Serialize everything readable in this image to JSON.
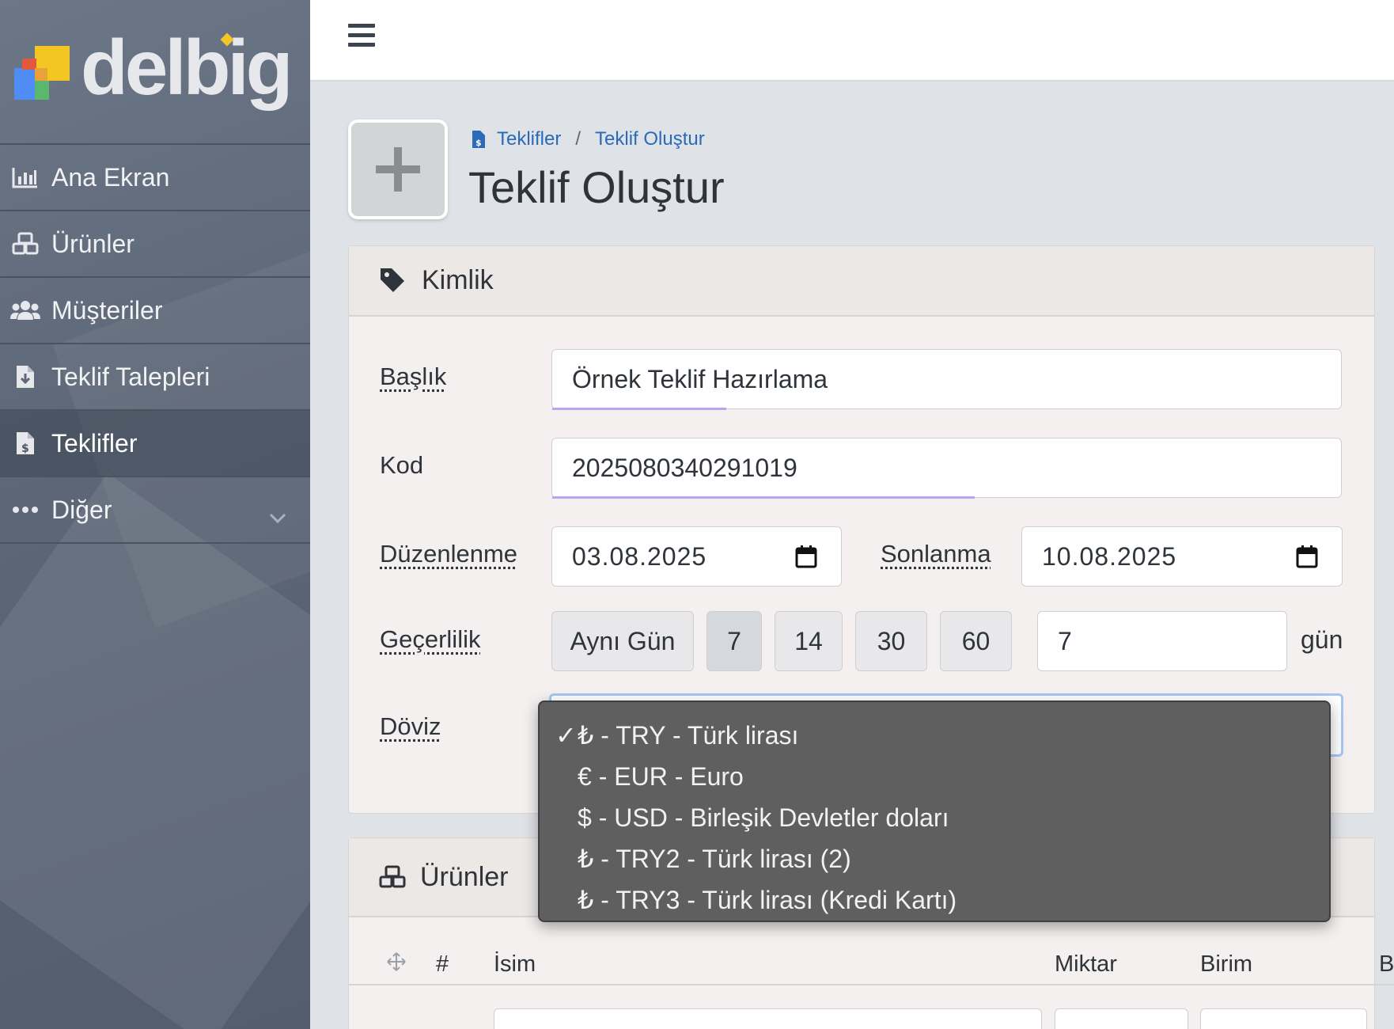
{
  "brand": {
    "name": "delbig"
  },
  "sidebar": {
    "items": [
      {
        "label": "Ana Ekran",
        "icon": "chart-bar-icon"
      },
      {
        "label": "Ürünler",
        "icon": "boxes-icon"
      },
      {
        "label": "Müşteriler",
        "icon": "users-icon"
      },
      {
        "label": "Teklif Talepleri",
        "icon": "file-download-icon"
      },
      {
        "label": "Teklifler",
        "icon": "file-invoice-dollar-icon",
        "active": true
      },
      {
        "label": "Diğer",
        "icon": "ellipsis-icon"
      }
    ]
  },
  "header": {
    "breadcrumb": [
      "Teklifler",
      "Teklif Oluştur"
    ],
    "title": "Teklif Oluştur"
  },
  "identity_card": {
    "title": "Kimlik",
    "baslik": {
      "label": "Başlık",
      "value": "Örnek Teklif Hazırlama"
    },
    "kod": {
      "label": "Kod",
      "value": "2025080340291019"
    },
    "duzenlenme": {
      "label": "Düzenlenme",
      "value": "03.08.2025"
    },
    "sonlanma": {
      "label": "Sonlanma",
      "value": "10.08.2025"
    },
    "gecerlilik": {
      "label": "Geçerlilik",
      "options": [
        "Aynı Gün",
        "7",
        "14",
        "30",
        "60"
      ],
      "selected": "7",
      "value": "7",
      "unit": "gün"
    },
    "doviz": {
      "label": "Döviz",
      "options": [
        "₺ - TRY - Türk lirası",
        "€ - EUR - Euro",
        "$ - USD - Birleşik Devletler doları",
        "₺ - TRY2 - Türk lirası (2)",
        "₺ - TRY3 - Türk lirası (Kredi Kartı)"
      ],
      "selected_index": 0,
      "checkmark": "✓"
    }
  },
  "products_card": {
    "title": "Ürünler",
    "columns": [
      "#",
      "İsim",
      "Miktar",
      "Birim",
      "B"
    ]
  },
  "colors": {
    "sidebar": "#5c6676",
    "link": "#2a6ab8",
    "dropdown": "#5f5f5f"
  }
}
